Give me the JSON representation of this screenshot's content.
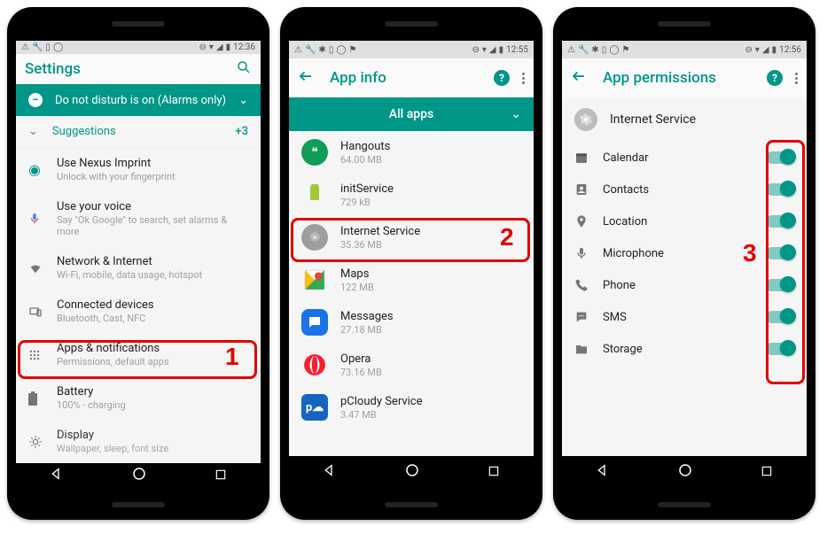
{
  "phone1": {
    "time": "12:36",
    "title": "Settings",
    "dnd": "Do not disturb is on (Alarms only)",
    "suggestions_label": "Suggestions",
    "suggestions_count": "+3",
    "nexus": {
      "title": "Use Nexus Imprint",
      "sub": "Unlock with your fingerprint"
    },
    "voice": {
      "title": "Use your voice",
      "sub": "Say \"Ok Google\" to search, set alarms & more"
    },
    "network": {
      "title": "Network & Internet",
      "sub": "Wi-Fi, mobile, data usage, hotspot"
    },
    "devices": {
      "title": "Connected devices",
      "sub": "Bluetooth, Cast, NFC"
    },
    "apps": {
      "title": "Apps & notifications",
      "sub": "Permissions, default apps"
    },
    "battery": {
      "title": "Battery",
      "sub": "100% - charging"
    },
    "display": {
      "title": "Display",
      "sub": "Wallpaper, sleep, font size"
    },
    "annotation": "1"
  },
  "phone2": {
    "time": "12:55",
    "title": "App info",
    "allapps": "All apps",
    "apps": [
      {
        "name": "Hangouts",
        "size": "64.00 MB",
        "color": "#0f9d58",
        "letter": "H"
      },
      {
        "name": "initService",
        "size": "729 kB",
        "color": "#a4c639",
        "letter": "A"
      },
      {
        "name": "Internet Service",
        "size": "35.36 MB",
        "color": "#9e9e9e",
        "letter": "⚙"
      },
      {
        "name": "Maps",
        "size": "122 MB",
        "color": "#34a853",
        "letter": "G"
      },
      {
        "name": "Messages",
        "size": "27.18 MB",
        "color": "#1a73e8",
        "letter": "M"
      },
      {
        "name": "Opera",
        "size": "73.16 MB",
        "color": "#ff1b2d",
        "letter": "O"
      },
      {
        "name": "pCloudy Service",
        "size": "3.47 MB",
        "color": "#1565c0",
        "letter": "p"
      }
    ],
    "annotation": "2"
  },
  "phone3": {
    "time": "12:56",
    "title": "App permissions",
    "appname": "Internet Service",
    "perms": [
      "Calendar",
      "Contacts",
      "Location",
      "Microphone",
      "Phone",
      "SMS",
      "Storage"
    ],
    "annotation": "3"
  }
}
